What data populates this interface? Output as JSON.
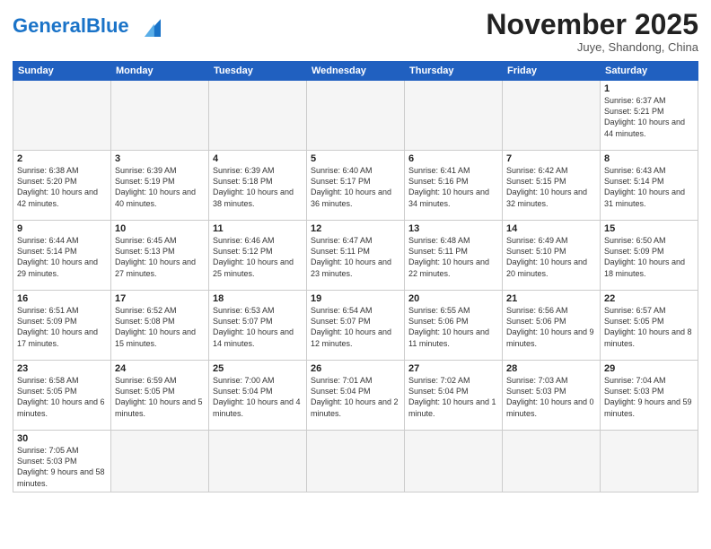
{
  "header": {
    "logo_general": "General",
    "logo_blue": "Blue",
    "month_title": "November 2025",
    "subtitle": "Juye, Shandong, China"
  },
  "weekdays": [
    "Sunday",
    "Monday",
    "Tuesday",
    "Wednesday",
    "Thursday",
    "Friday",
    "Saturday"
  ],
  "weeks": [
    [
      {
        "day": "",
        "info": ""
      },
      {
        "day": "",
        "info": ""
      },
      {
        "day": "",
        "info": ""
      },
      {
        "day": "",
        "info": ""
      },
      {
        "day": "",
        "info": ""
      },
      {
        "day": "",
        "info": ""
      },
      {
        "day": "1",
        "info": "Sunrise: 6:37 AM\nSunset: 5:21 PM\nDaylight: 10 hours and 44 minutes."
      }
    ],
    [
      {
        "day": "2",
        "info": "Sunrise: 6:38 AM\nSunset: 5:20 PM\nDaylight: 10 hours and 42 minutes."
      },
      {
        "day": "3",
        "info": "Sunrise: 6:39 AM\nSunset: 5:19 PM\nDaylight: 10 hours and 40 minutes."
      },
      {
        "day": "4",
        "info": "Sunrise: 6:39 AM\nSunset: 5:18 PM\nDaylight: 10 hours and 38 minutes."
      },
      {
        "day": "5",
        "info": "Sunrise: 6:40 AM\nSunset: 5:17 PM\nDaylight: 10 hours and 36 minutes."
      },
      {
        "day": "6",
        "info": "Sunrise: 6:41 AM\nSunset: 5:16 PM\nDaylight: 10 hours and 34 minutes."
      },
      {
        "day": "7",
        "info": "Sunrise: 6:42 AM\nSunset: 5:15 PM\nDaylight: 10 hours and 32 minutes."
      },
      {
        "day": "8",
        "info": "Sunrise: 6:43 AM\nSunset: 5:14 PM\nDaylight: 10 hours and 31 minutes."
      }
    ],
    [
      {
        "day": "9",
        "info": "Sunrise: 6:44 AM\nSunset: 5:14 PM\nDaylight: 10 hours and 29 minutes."
      },
      {
        "day": "10",
        "info": "Sunrise: 6:45 AM\nSunset: 5:13 PM\nDaylight: 10 hours and 27 minutes."
      },
      {
        "day": "11",
        "info": "Sunrise: 6:46 AM\nSunset: 5:12 PM\nDaylight: 10 hours and 25 minutes."
      },
      {
        "day": "12",
        "info": "Sunrise: 6:47 AM\nSunset: 5:11 PM\nDaylight: 10 hours and 23 minutes."
      },
      {
        "day": "13",
        "info": "Sunrise: 6:48 AM\nSunset: 5:11 PM\nDaylight: 10 hours and 22 minutes."
      },
      {
        "day": "14",
        "info": "Sunrise: 6:49 AM\nSunset: 5:10 PM\nDaylight: 10 hours and 20 minutes."
      },
      {
        "day": "15",
        "info": "Sunrise: 6:50 AM\nSunset: 5:09 PM\nDaylight: 10 hours and 18 minutes."
      }
    ],
    [
      {
        "day": "16",
        "info": "Sunrise: 6:51 AM\nSunset: 5:09 PM\nDaylight: 10 hours and 17 minutes."
      },
      {
        "day": "17",
        "info": "Sunrise: 6:52 AM\nSunset: 5:08 PM\nDaylight: 10 hours and 15 minutes."
      },
      {
        "day": "18",
        "info": "Sunrise: 6:53 AM\nSunset: 5:07 PM\nDaylight: 10 hours and 14 minutes."
      },
      {
        "day": "19",
        "info": "Sunrise: 6:54 AM\nSunset: 5:07 PM\nDaylight: 10 hours and 12 minutes."
      },
      {
        "day": "20",
        "info": "Sunrise: 6:55 AM\nSunset: 5:06 PM\nDaylight: 10 hours and 11 minutes."
      },
      {
        "day": "21",
        "info": "Sunrise: 6:56 AM\nSunset: 5:06 PM\nDaylight: 10 hours and 9 minutes."
      },
      {
        "day": "22",
        "info": "Sunrise: 6:57 AM\nSunset: 5:05 PM\nDaylight: 10 hours and 8 minutes."
      }
    ],
    [
      {
        "day": "23",
        "info": "Sunrise: 6:58 AM\nSunset: 5:05 PM\nDaylight: 10 hours and 6 minutes."
      },
      {
        "day": "24",
        "info": "Sunrise: 6:59 AM\nSunset: 5:05 PM\nDaylight: 10 hours and 5 minutes."
      },
      {
        "day": "25",
        "info": "Sunrise: 7:00 AM\nSunset: 5:04 PM\nDaylight: 10 hours and 4 minutes."
      },
      {
        "day": "26",
        "info": "Sunrise: 7:01 AM\nSunset: 5:04 PM\nDaylight: 10 hours and 2 minutes."
      },
      {
        "day": "27",
        "info": "Sunrise: 7:02 AM\nSunset: 5:04 PM\nDaylight: 10 hours and 1 minute."
      },
      {
        "day": "28",
        "info": "Sunrise: 7:03 AM\nSunset: 5:03 PM\nDaylight: 10 hours and 0 minutes."
      },
      {
        "day": "29",
        "info": "Sunrise: 7:04 AM\nSunset: 5:03 PM\nDaylight: 9 hours and 59 minutes."
      }
    ],
    [
      {
        "day": "30",
        "info": "Sunrise: 7:05 AM\nSunset: 5:03 PM\nDaylight: 9 hours and 58 minutes."
      },
      {
        "day": "",
        "info": ""
      },
      {
        "day": "",
        "info": ""
      },
      {
        "day": "",
        "info": ""
      },
      {
        "day": "",
        "info": ""
      },
      {
        "day": "",
        "info": ""
      },
      {
        "day": "",
        "info": ""
      }
    ]
  ]
}
